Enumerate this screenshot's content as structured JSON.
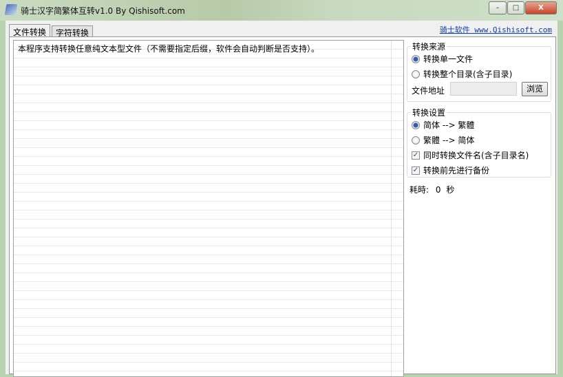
{
  "window": {
    "title": "骑士汉字简繁体互转v1.0 By Qishisoft.com",
    "minimize": "–",
    "maximize": "□",
    "close": "X"
  },
  "tabs": [
    {
      "label": "文件转换",
      "active": true
    },
    {
      "label": "字符转换",
      "active": false
    }
  ],
  "site_link": "骑士软件 www.Qishisoft.com",
  "textarea": {
    "text": "本程序支持转换任意纯文本型文件（不需要指定后缀，软件会自动判断是否支持）。"
  },
  "source_group": {
    "title": "转换来源",
    "options": [
      {
        "label": "转换单一文件",
        "selected": true
      },
      {
        "label": "转换整个目录(含子目录)",
        "selected": false
      }
    ],
    "path_label": "文件地址",
    "path_value": "",
    "browse": "浏览"
  },
  "settings_group": {
    "title": "转换设置",
    "options": [
      {
        "label": "简体 --> 繁體",
        "selected": true
      },
      {
        "label": "繁體 --> 简体",
        "selected": false
      }
    ],
    "checks": [
      {
        "label": "同时转换文件名(含子目录名)",
        "checked": true
      },
      {
        "label": "转换前先进行备份",
        "checked": true
      }
    ]
  },
  "elapsed": {
    "label": "耗時:",
    "value": "0",
    "unit": "秒"
  }
}
